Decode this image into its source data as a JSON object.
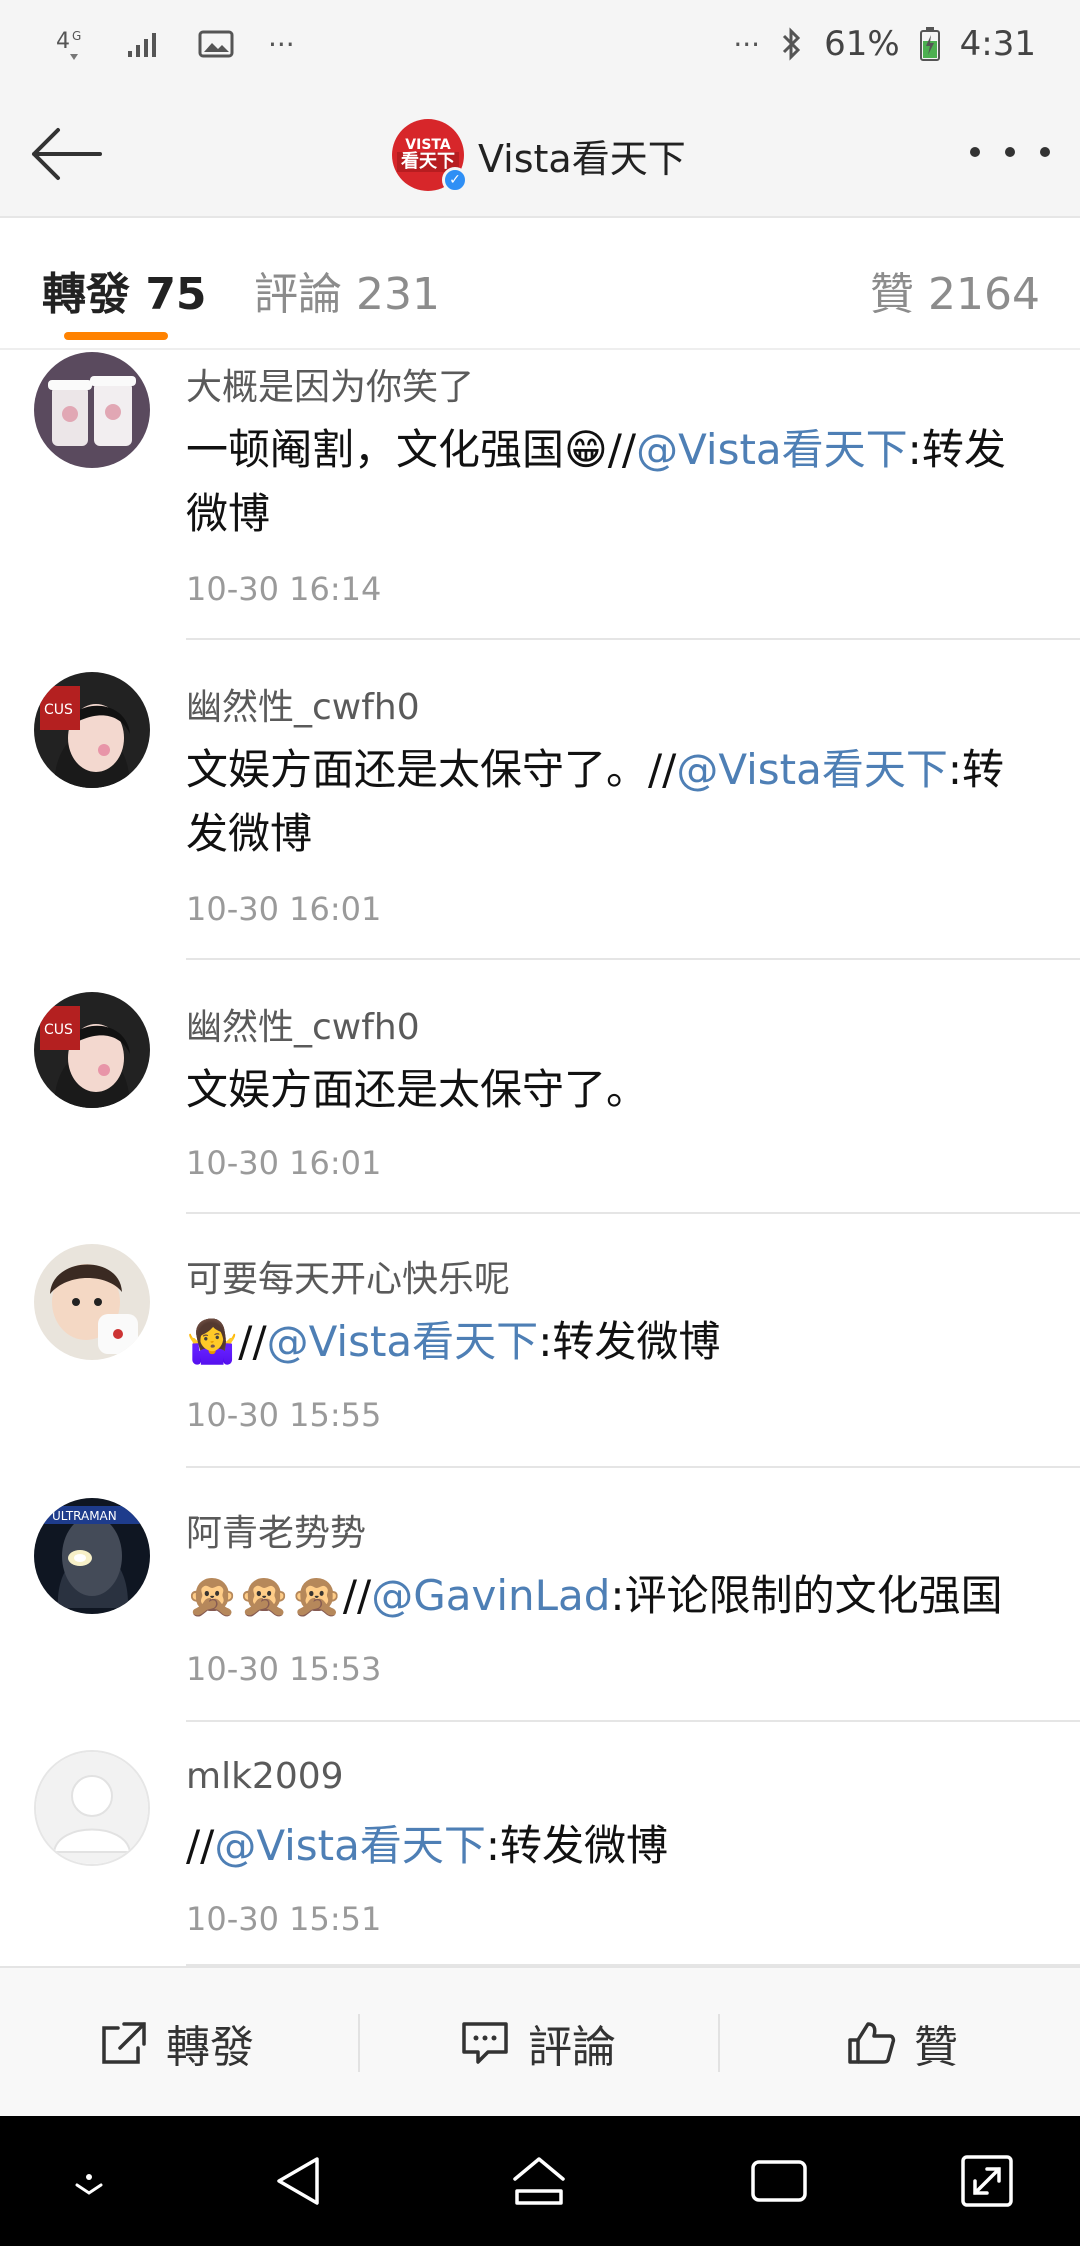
{
  "status_bar": {
    "network": "4G",
    "more_left": "···",
    "more_right": "···",
    "battery": "61%",
    "time": "4:31"
  },
  "header": {
    "account_name": "Vista看天下",
    "logo_text_top": "VISTA",
    "logo_text_bottom": "看天下"
  },
  "tabs": {
    "repost": "轉發 75",
    "comment": "評論 231",
    "like": "贊 2164",
    "active_color": "#ff8200"
  },
  "reposts": [
    {
      "user": "大概是因为你笑了",
      "pre": "一顿阉割，文化强国😁//",
      "mention": "@Vista看天下",
      "post": ":转发微博",
      "time": "10-30 16:14"
    },
    {
      "user": "幽然性_cwfh0",
      "pre": "文娱方面还是太保守了。//",
      "mention": "@Vista看天下",
      "post": ":转发微博",
      "time": "10-30 16:01"
    },
    {
      "user": "幽然性_cwfh0",
      "pre": "文娱方面还是太保守了。",
      "mention": "",
      "post": "",
      "time": "10-30 16:01"
    },
    {
      "user": "可要每天开心快乐呢",
      "pre": "🤷‍♀️//",
      "mention": "@Vista看天下",
      "post": ":转发微博",
      "time": "10-30 15:55"
    },
    {
      "user": "阿青老势势",
      "pre": "🙊🙊🙊//",
      "mention": "@GavinLad",
      "post": ":评论限制的文化强国",
      "time": "10-30 15:53"
    },
    {
      "user": "mlk2009",
      "pre": "//",
      "mention": "@Vista看天下",
      "post": ":转发微博",
      "time": "10-30 15:51"
    }
  ],
  "actions": {
    "repost": "轉發",
    "comment": "評論",
    "like": "贊"
  },
  "colors": {
    "mention": "#4e7fb5",
    "header_bg": "#f5f5f5",
    "verified": "#2f8ff5"
  }
}
